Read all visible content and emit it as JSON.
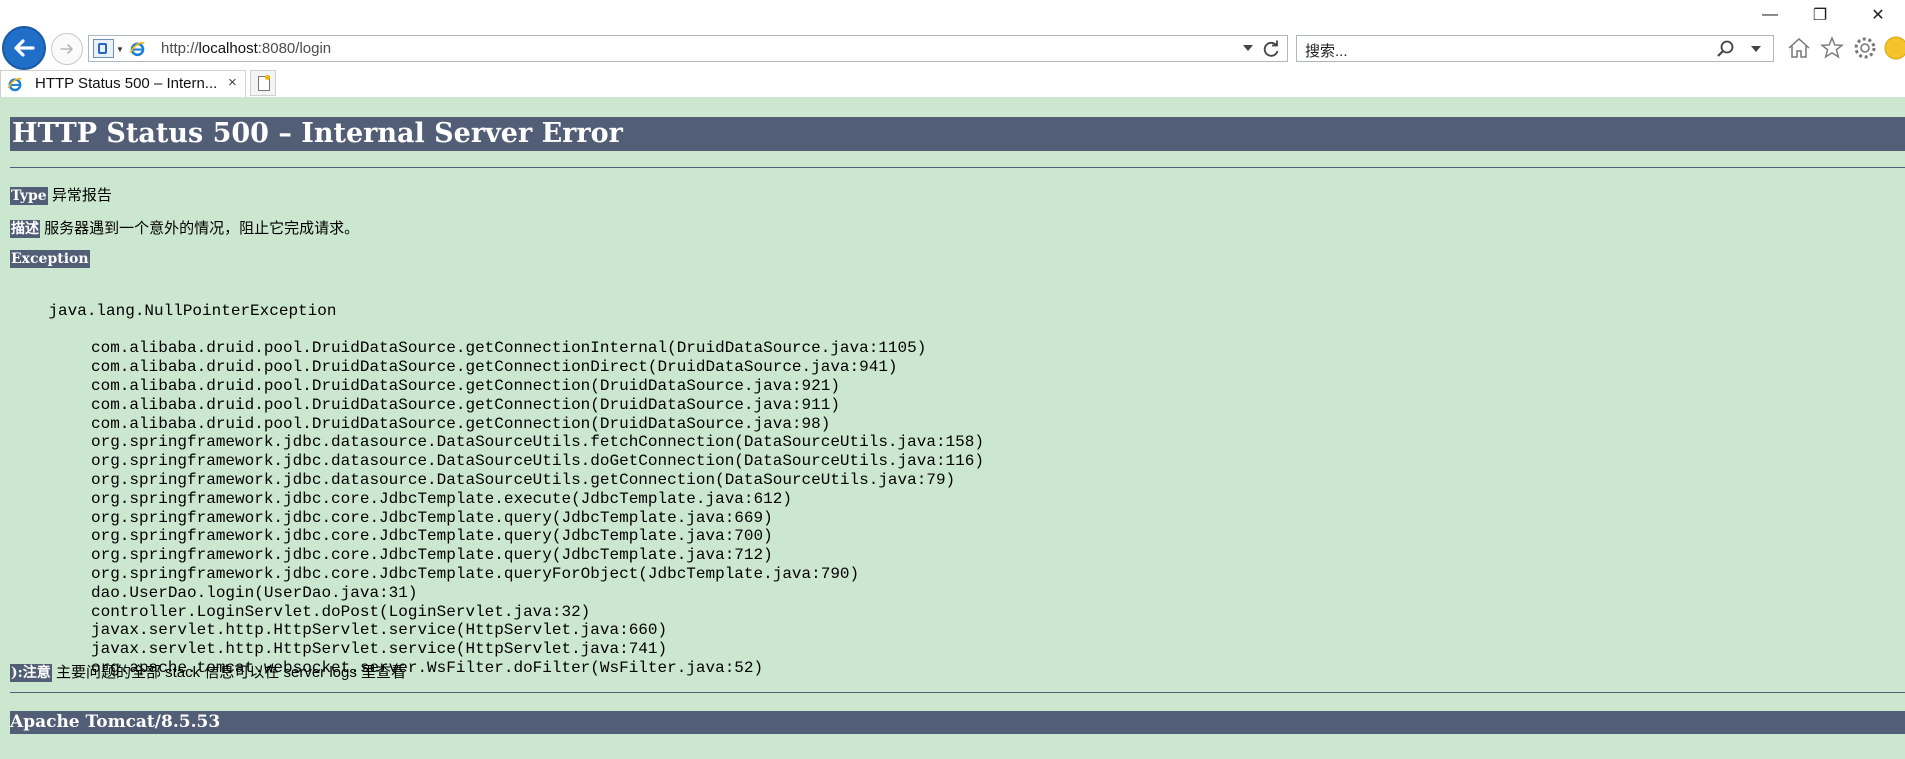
{
  "browser": {
    "address_url": "http://localhost:8080/login",
    "url_prefix": "http://",
    "url_host": "localhost",
    "url_rest": ":8080/login",
    "search_placeholder": "搜索...",
    "tab_title": "HTTP Status 500 – Intern...",
    "tab_close": "×",
    "minimize": "—",
    "restore": "❐",
    "close": "✕",
    "accent": "#1f6fc8"
  },
  "page": {
    "heading": "HTTP Status 500 – Internal Server Error",
    "type_label": "Type",
    "type_value": "异常报告",
    "desc_label": "描述",
    "desc_value": "服务器遇到一个意外的情况，阻止它完成请求。",
    "exception_label": "Exception",
    "exception_name": "java.lang.NullPointerException",
    "stack": [
      "com.alibaba.druid.pool.DruidDataSource.getConnectionInternal(DruidDataSource.java:1105)",
      "com.alibaba.druid.pool.DruidDataSource.getConnectionDirect(DruidDataSource.java:941)",
      "com.alibaba.druid.pool.DruidDataSource.getConnection(DruidDataSource.java:921)",
      "com.alibaba.druid.pool.DruidDataSource.getConnection(DruidDataSource.java:911)",
      "com.alibaba.druid.pool.DruidDataSource.getConnection(DruidDataSource.java:98)",
      "org.springframework.jdbc.datasource.DataSourceUtils.fetchConnection(DataSourceUtils.java:158)",
      "org.springframework.jdbc.datasource.DataSourceUtils.doGetConnection(DataSourceUtils.java:116)",
      "org.springframework.jdbc.datasource.DataSourceUtils.getConnection(DataSourceUtils.java:79)",
      "org.springframework.jdbc.core.JdbcTemplate.execute(JdbcTemplate.java:612)",
      "org.springframework.jdbc.core.JdbcTemplate.query(JdbcTemplate.java:669)",
      "org.springframework.jdbc.core.JdbcTemplate.query(JdbcTemplate.java:700)",
      "org.springframework.jdbc.core.JdbcTemplate.query(JdbcTemplate.java:712)",
      "org.springframework.jdbc.core.JdbcTemplate.queryForObject(JdbcTemplate.java:790)",
      "dao.UserDao.login(UserDao.java:31)",
      "controller.LoginServlet.doPost(LoginServlet.java:32)",
      "javax.servlet.http.HttpServlet.service(HttpServlet.java:660)",
      "javax.servlet.http.HttpServlet.service(HttpServlet.java:741)",
      "org.apache.tomcat.websocket.server.WsFilter.doFilter(WsFilter.java:52)"
    ],
    "note_label": "):注意",
    "note_value": "主要问题的全部 stack 信息可以在 server logs 里查看",
    "footer": "Apache Tomcat/8.5.53",
    "header_bg": "#525d76",
    "page_bg": "#cce7cf"
  }
}
